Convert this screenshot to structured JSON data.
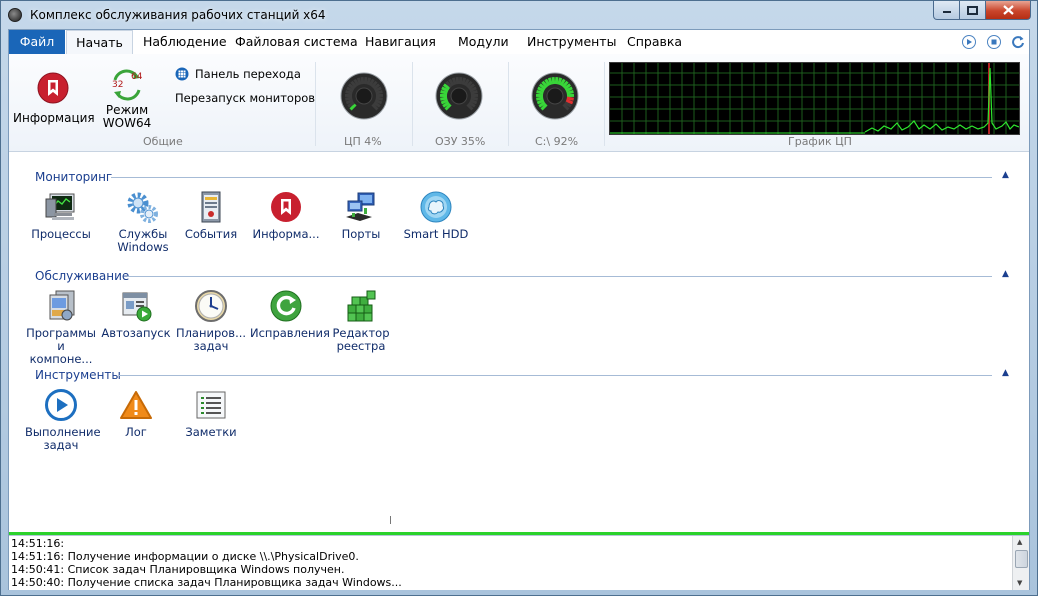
{
  "window": {
    "title": "Комплекс обслуживания рабочих станций x64"
  },
  "menu": {
    "items": [
      "Файл",
      "Начать",
      "Наблюдение",
      "Файловая система",
      "Навигация",
      "Модули",
      "Инструменты",
      "Справка"
    ],
    "active_index": 1
  },
  "quick_access": [
    "play-icon",
    "stop-icon",
    "refresh-icon"
  ],
  "ribbon": {
    "general": {
      "info_label": "Информация",
      "wow_label": "Режим\nWOW64",
      "wow_numbers": [
        "32",
        "64"
      ],
      "nav_panel_label": "Панель перехода",
      "restart_monitors_label": "Перезапуск мониторов",
      "group_label": "Общие"
    },
    "gauges": [
      {
        "label": "ЦП 4%",
        "percent": 4
      },
      {
        "label": "ОЗУ 35%",
        "percent": 35
      },
      {
        "label": "C:\\ 92%",
        "percent": 92
      }
    ],
    "cpu_graph_label": "График ЦП"
  },
  "sections": [
    {
      "title": "Мониторинг",
      "items": [
        {
          "label": "Процессы",
          "icon": "monitor-icon"
        },
        {
          "label": "Службы\nWindows",
          "icon": "gears-icon"
        },
        {
          "label": "События",
          "icon": "event-log-icon"
        },
        {
          "label": "Информа...",
          "icon": "info-badge-icon"
        },
        {
          "label": "Порты",
          "icon": "network-ports-icon"
        },
        {
          "label": "Smart HDD",
          "icon": "brain-disk-icon"
        }
      ]
    },
    {
      "title": "Обслуживание",
      "items": [
        {
          "label": "Программы\nи компоне...",
          "icon": "programs-icon"
        },
        {
          "label": "Автозапуск",
          "icon": "autorun-icon"
        },
        {
          "label": "Планиров...\nзадач",
          "icon": "clock-icon"
        },
        {
          "label": "Исправления",
          "icon": "fix-refresh-icon"
        },
        {
          "label": "Редактор\nреестра",
          "icon": "registry-icon"
        }
      ]
    },
    {
      "title": "Инструменты",
      "items": [
        {
          "label": "Выполнение\nзадач",
          "icon": "play-circle-icon"
        },
        {
          "label": "Лог",
          "icon": "warning-icon"
        },
        {
          "label": "Заметки",
          "icon": "notes-icon"
        }
      ]
    }
  ],
  "log": [
    "14:51:16:",
    "14:51:16: Получение информации о диске \\\\.\\PhysicalDrive0.",
    "14:50:41: Список задач Планировщика Windows получен.",
    "14:50:40: Получение списка задач Планировщика задач Windows..."
  ],
  "colors": {
    "accent": "#1a66b8",
    "status_green": "#2bd22b",
    "section_text": "#1b3f8f"
  }
}
